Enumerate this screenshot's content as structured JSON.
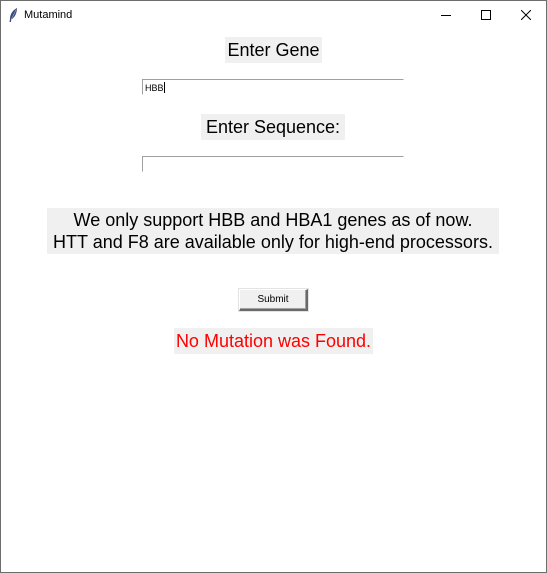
{
  "window": {
    "title": "Mutamind",
    "icon": "feather-icon"
  },
  "controls": {
    "minimize_icon": "minimize-icon",
    "maximize_icon": "maximize-icon",
    "close_icon": "close-icon"
  },
  "form": {
    "gene_label": "Enter Gene",
    "gene_value": "HBB",
    "sequence_label": "Enter Sequence:",
    "sequence_value": "",
    "info_line1": "We only support HBB and HBA1 genes as of now.",
    "info_line2": "HTT and F8 are available only for high-end processors.",
    "submit_label": "Submit",
    "result_text": "No Mutation was Found."
  },
  "colors": {
    "label_background": "#f0f0f0",
    "result_color": "#ff0000",
    "window_background": "#ffffff"
  }
}
